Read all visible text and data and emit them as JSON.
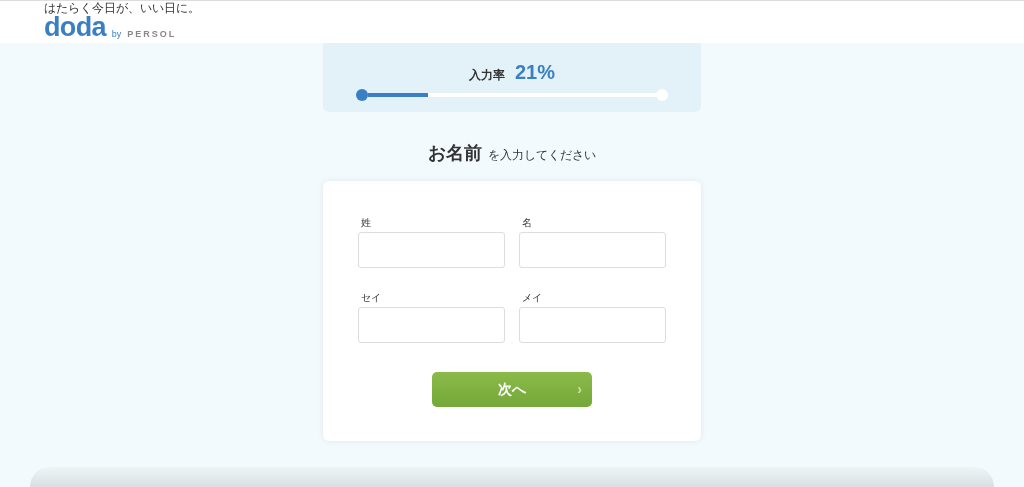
{
  "header": {
    "tagline": "はたらく今日が、いい日に。",
    "logo": "doda",
    "by": "by",
    "brand": "PERSOL"
  },
  "progress": {
    "label": "入力率",
    "percent": "21%",
    "level": 0.21
  },
  "heading": {
    "main": "お名前",
    "sub": "を入力してください"
  },
  "fields": [
    {
      "label": "姓"
    },
    {
      "label": "名"
    },
    {
      "label": "セイ"
    },
    {
      "label": "メイ"
    }
  ],
  "next_button": {
    "label": "次へ",
    "arrow": "›"
  }
}
